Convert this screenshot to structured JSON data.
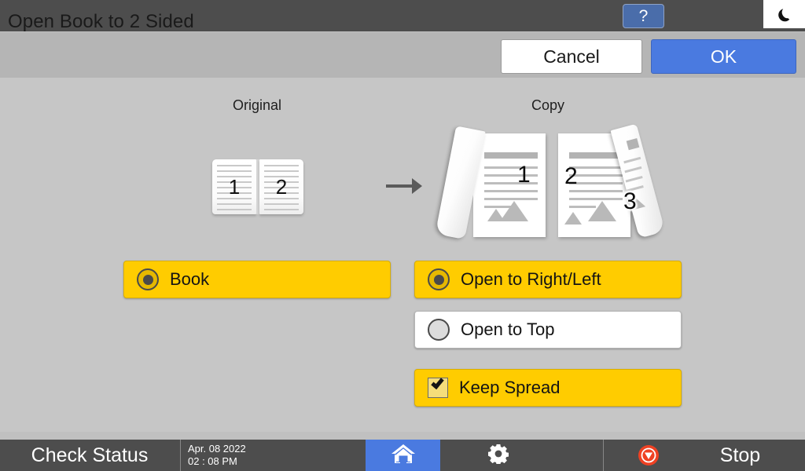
{
  "topbar": {
    "help_label": "?",
    "help_icon": "question-mark-icon",
    "sleep_icon": "moon-icon"
  },
  "titlebar": {
    "title": "Open Book to 2 Sided",
    "cancel_label": "Cancel",
    "ok_label": "OK"
  },
  "main": {
    "original_label": "Original",
    "copy_label": "Copy",
    "arrow_icon": "arrow-right-icon",
    "original_preview": {
      "left_page_number": "1",
      "right_page_number": "2"
    },
    "copy_preview": {
      "sheet1_number": "1",
      "sheet2_number": "2",
      "sheet2_flip_number": "3"
    },
    "original_options": [
      {
        "label": "Book",
        "control": "radio",
        "selected": true
      }
    ],
    "copy_options": [
      {
        "label": "Open to Right/Left",
        "control": "radio",
        "selected": true
      },
      {
        "label": "Open to Top",
        "control": "radio",
        "selected": false
      },
      {
        "label": "Keep Spread",
        "control": "checkbox",
        "checked": true
      }
    ]
  },
  "bottombar": {
    "check_status_label": "Check Status",
    "date": "Apr. 08 2022",
    "time": "02 : 08 PM",
    "home_icon": "home-icon",
    "settings_icon": "gear-icon",
    "stop_icon": "stop-icon",
    "stop_label": "Stop"
  },
  "colors": {
    "accent_blue": "#4a7ae0",
    "option_yellow": "#ffcc00",
    "bar_dark": "#4d4d4d",
    "body_gray": "#c6c6c6",
    "stop_red": "#ef4123"
  }
}
